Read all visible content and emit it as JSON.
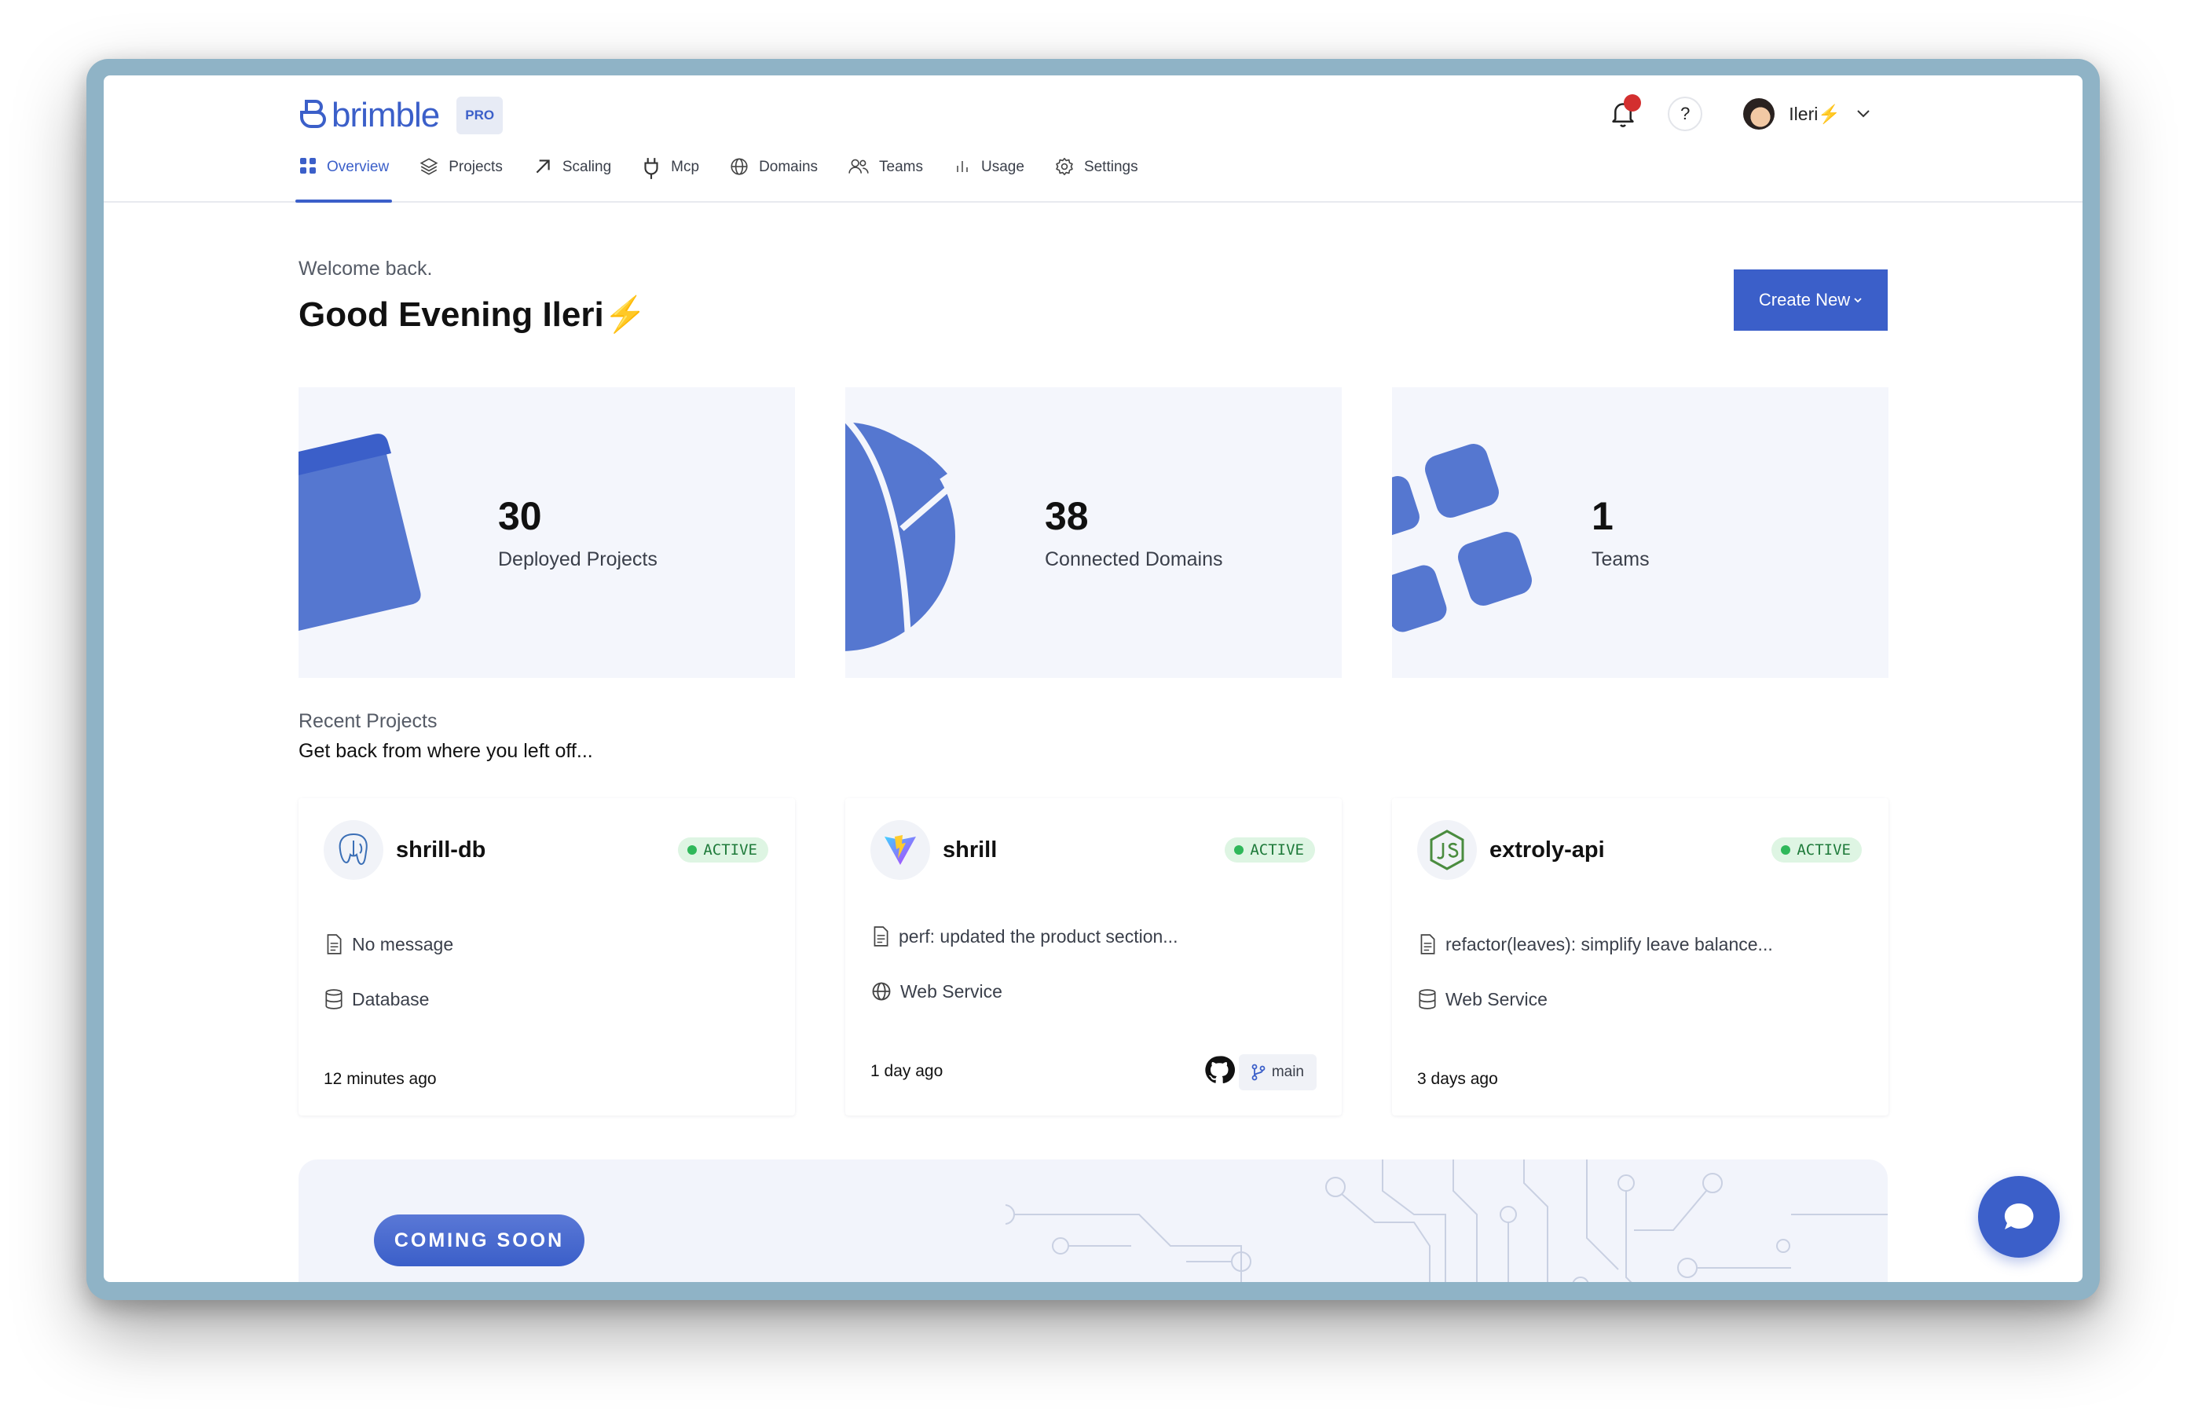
{
  "app": {
    "logo_text": "brimble",
    "plan_badge": "PRO"
  },
  "header": {
    "user_name": "Ileri",
    "user_suffix": "⚡",
    "help_label": "?"
  },
  "nav": [
    {
      "label": "Overview",
      "icon": "grid-icon",
      "active": true
    },
    {
      "label": "Projects",
      "icon": "layers-icon",
      "active": false
    },
    {
      "label": "Scaling",
      "icon": "arrow-up-right-icon",
      "active": false
    },
    {
      "label": "Mcp",
      "icon": "plug-icon",
      "active": false
    },
    {
      "label": "Domains",
      "icon": "globe-icon",
      "active": false
    },
    {
      "label": "Teams",
      "icon": "users-icon",
      "active": false
    },
    {
      "label": "Usage",
      "icon": "bar-chart-icon",
      "active": false
    },
    {
      "label": "Settings",
      "icon": "gear-icon",
      "active": false
    }
  ],
  "welcome": {
    "line": "Welcome back.",
    "greeting": "Good Evening Ileri",
    "greeting_suffix": "⚡"
  },
  "create_button": {
    "label": "Create New"
  },
  "stats": [
    {
      "value": "30",
      "label": "Deployed Projects"
    },
    {
      "value": "38",
      "label": "Connected Domains"
    },
    {
      "value": "1",
      "label": "Teams"
    }
  ],
  "recent": {
    "title": "Recent Projects",
    "subtitle": "Get back from where you left off...",
    "projects": [
      {
        "name": "shrill-db",
        "status": "ACTIVE",
        "message": "No message",
        "type": "Database",
        "time": "12 minutes ago",
        "icon": "postgres-icon"
      },
      {
        "name": "shrill",
        "status": "ACTIVE",
        "message": "perf: updated the product section...",
        "type": "Web Service",
        "time": "1 day ago",
        "icon": "vite-icon",
        "branch": "main"
      },
      {
        "name": "extroly-api",
        "status": "ACTIVE",
        "message": "refactor(leaves): simplify leave balance...",
        "type": "Web Service",
        "time": "3 days ago",
        "icon": "nodejs-icon"
      }
    ]
  },
  "coming_soon": {
    "label": "COMING SOON"
  },
  "colors": {
    "accent": "#3b5fc9",
    "card_bg": "#f4f6fc",
    "active_badge": "#def5e3",
    "notification": "#d32f2f"
  }
}
